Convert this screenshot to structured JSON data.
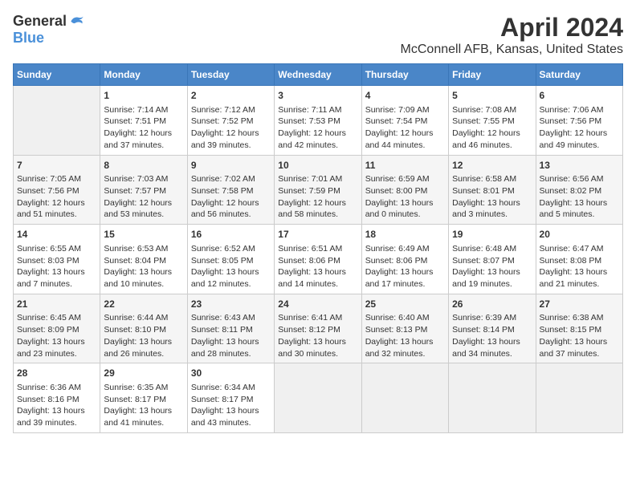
{
  "header": {
    "logo_general": "General",
    "logo_blue": "Blue",
    "title": "April 2024",
    "subtitle": "McConnell AFB, Kansas, United States"
  },
  "days_of_week": [
    "Sunday",
    "Monday",
    "Tuesday",
    "Wednesday",
    "Thursday",
    "Friday",
    "Saturday"
  ],
  "weeks": [
    [
      {
        "day": "",
        "empty": true
      },
      {
        "day": "1",
        "sunrise": "Sunrise: 7:14 AM",
        "sunset": "Sunset: 7:51 PM",
        "daylight": "Daylight: 12 hours and 37 minutes."
      },
      {
        "day": "2",
        "sunrise": "Sunrise: 7:12 AM",
        "sunset": "Sunset: 7:52 PM",
        "daylight": "Daylight: 12 hours and 39 minutes."
      },
      {
        "day": "3",
        "sunrise": "Sunrise: 7:11 AM",
        "sunset": "Sunset: 7:53 PM",
        "daylight": "Daylight: 12 hours and 42 minutes."
      },
      {
        "day": "4",
        "sunrise": "Sunrise: 7:09 AM",
        "sunset": "Sunset: 7:54 PM",
        "daylight": "Daylight: 12 hours and 44 minutes."
      },
      {
        "day": "5",
        "sunrise": "Sunrise: 7:08 AM",
        "sunset": "Sunset: 7:55 PM",
        "daylight": "Daylight: 12 hours and 46 minutes."
      },
      {
        "day": "6",
        "sunrise": "Sunrise: 7:06 AM",
        "sunset": "Sunset: 7:56 PM",
        "daylight": "Daylight: 12 hours and 49 minutes."
      }
    ],
    [
      {
        "day": "7",
        "sunrise": "Sunrise: 7:05 AM",
        "sunset": "Sunset: 7:56 PM",
        "daylight": "Daylight: 12 hours and 51 minutes."
      },
      {
        "day": "8",
        "sunrise": "Sunrise: 7:03 AM",
        "sunset": "Sunset: 7:57 PM",
        "daylight": "Daylight: 12 hours and 53 minutes."
      },
      {
        "day": "9",
        "sunrise": "Sunrise: 7:02 AM",
        "sunset": "Sunset: 7:58 PM",
        "daylight": "Daylight: 12 hours and 56 minutes."
      },
      {
        "day": "10",
        "sunrise": "Sunrise: 7:01 AM",
        "sunset": "Sunset: 7:59 PM",
        "daylight": "Daylight: 12 hours and 58 minutes."
      },
      {
        "day": "11",
        "sunrise": "Sunrise: 6:59 AM",
        "sunset": "Sunset: 8:00 PM",
        "daylight": "Daylight: 13 hours and 0 minutes."
      },
      {
        "day": "12",
        "sunrise": "Sunrise: 6:58 AM",
        "sunset": "Sunset: 8:01 PM",
        "daylight": "Daylight: 13 hours and 3 minutes."
      },
      {
        "day": "13",
        "sunrise": "Sunrise: 6:56 AM",
        "sunset": "Sunset: 8:02 PM",
        "daylight": "Daylight: 13 hours and 5 minutes."
      }
    ],
    [
      {
        "day": "14",
        "sunrise": "Sunrise: 6:55 AM",
        "sunset": "Sunset: 8:03 PM",
        "daylight": "Daylight: 13 hours and 7 minutes."
      },
      {
        "day": "15",
        "sunrise": "Sunrise: 6:53 AM",
        "sunset": "Sunset: 8:04 PM",
        "daylight": "Daylight: 13 hours and 10 minutes."
      },
      {
        "day": "16",
        "sunrise": "Sunrise: 6:52 AM",
        "sunset": "Sunset: 8:05 PM",
        "daylight": "Daylight: 13 hours and 12 minutes."
      },
      {
        "day": "17",
        "sunrise": "Sunrise: 6:51 AM",
        "sunset": "Sunset: 8:06 PM",
        "daylight": "Daylight: 13 hours and 14 minutes."
      },
      {
        "day": "18",
        "sunrise": "Sunrise: 6:49 AM",
        "sunset": "Sunset: 8:06 PM",
        "daylight": "Daylight: 13 hours and 17 minutes."
      },
      {
        "day": "19",
        "sunrise": "Sunrise: 6:48 AM",
        "sunset": "Sunset: 8:07 PM",
        "daylight": "Daylight: 13 hours and 19 minutes."
      },
      {
        "day": "20",
        "sunrise": "Sunrise: 6:47 AM",
        "sunset": "Sunset: 8:08 PM",
        "daylight": "Daylight: 13 hours and 21 minutes."
      }
    ],
    [
      {
        "day": "21",
        "sunrise": "Sunrise: 6:45 AM",
        "sunset": "Sunset: 8:09 PM",
        "daylight": "Daylight: 13 hours and 23 minutes."
      },
      {
        "day": "22",
        "sunrise": "Sunrise: 6:44 AM",
        "sunset": "Sunset: 8:10 PM",
        "daylight": "Daylight: 13 hours and 26 minutes."
      },
      {
        "day": "23",
        "sunrise": "Sunrise: 6:43 AM",
        "sunset": "Sunset: 8:11 PM",
        "daylight": "Daylight: 13 hours and 28 minutes."
      },
      {
        "day": "24",
        "sunrise": "Sunrise: 6:41 AM",
        "sunset": "Sunset: 8:12 PM",
        "daylight": "Daylight: 13 hours and 30 minutes."
      },
      {
        "day": "25",
        "sunrise": "Sunrise: 6:40 AM",
        "sunset": "Sunset: 8:13 PM",
        "daylight": "Daylight: 13 hours and 32 minutes."
      },
      {
        "day": "26",
        "sunrise": "Sunrise: 6:39 AM",
        "sunset": "Sunset: 8:14 PM",
        "daylight": "Daylight: 13 hours and 34 minutes."
      },
      {
        "day": "27",
        "sunrise": "Sunrise: 6:38 AM",
        "sunset": "Sunset: 8:15 PM",
        "daylight": "Daylight: 13 hours and 37 minutes."
      }
    ],
    [
      {
        "day": "28",
        "sunrise": "Sunrise: 6:36 AM",
        "sunset": "Sunset: 8:16 PM",
        "daylight": "Daylight: 13 hours and 39 minutes."
      },
      {
        "day": "29",
        "sunrise": "Sunrise: 6:35 AM",
        "sunset": "Sunset: 8:17 PM",
        "daylight": "Daylight: 13 hours and 41 minutes."
      },
      {
        "day": "30",
        "sunrise": "Sunrise: 6:34 AM",
        "sunset": "Sunset: 8:17 PM",
        "daylight": "Daylight: 13 hours and 43 minutes."
      },
      {
        "day": "",
        "empty": true
      },
      {
        "day": "",
        "empty": true
      },
      {
        "day": "",
        "empty": true
      },
      {
        "day": "",
        "empty": true
      }
    ]
  ]
}
